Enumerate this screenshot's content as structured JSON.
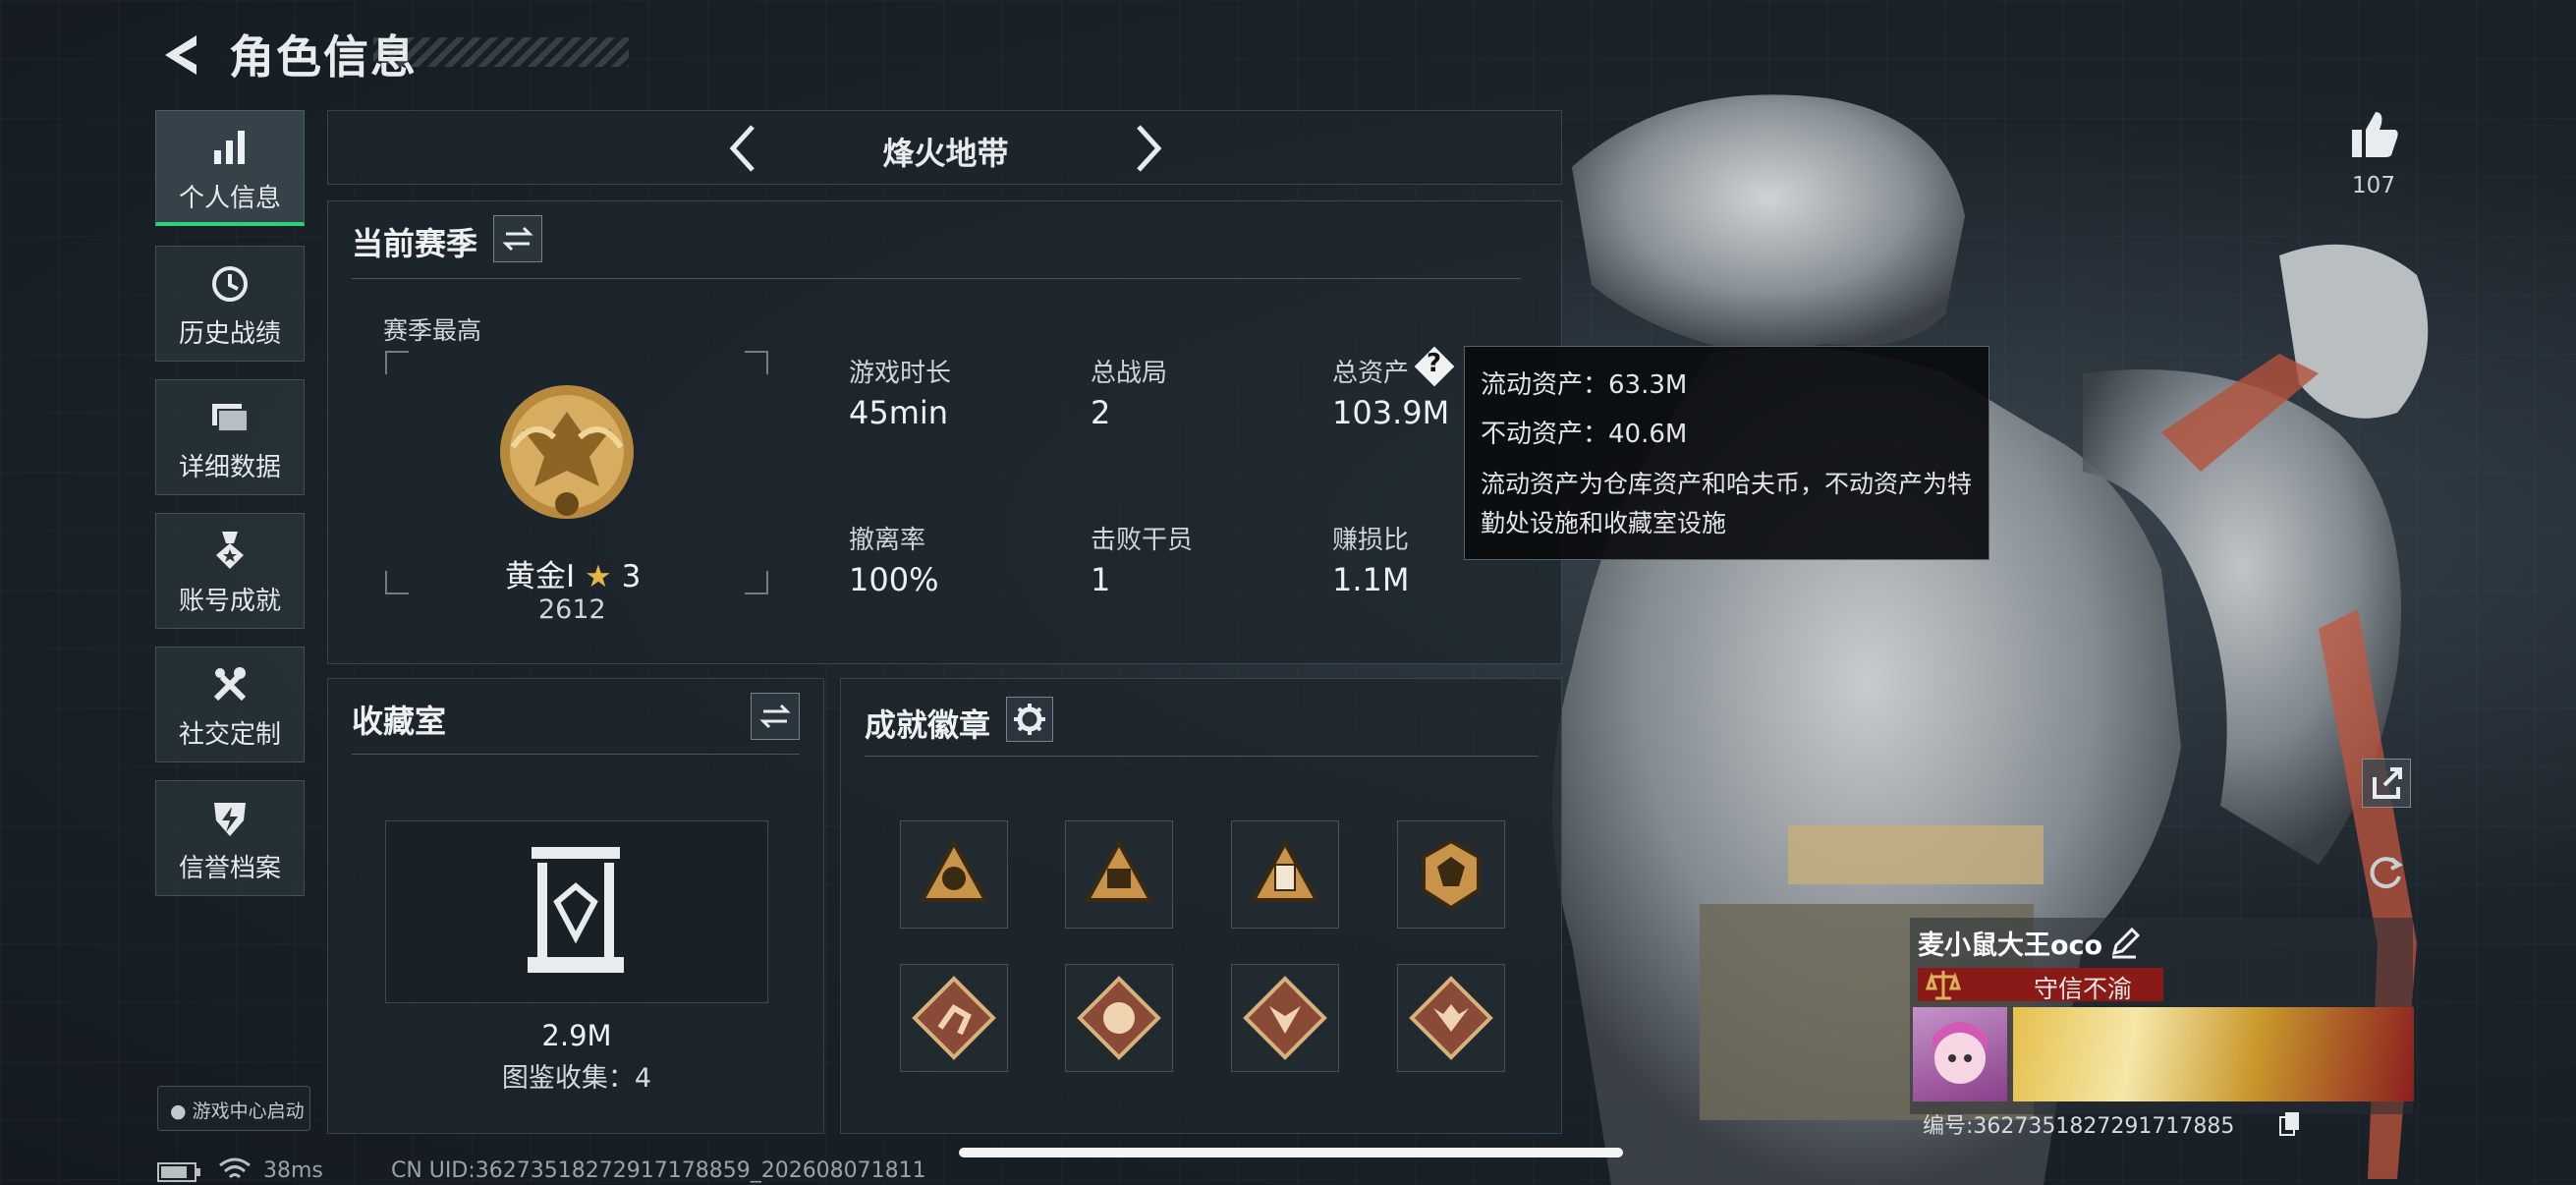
{
  "header": {
    "title": "角色信息"
  },
  "sidebar": {
    "items": [
      {
        "label": "个人信息",
        "icon": "bar-chart-icon",
        "active": true
      },
      {
        "label": "历史战绩",
        "icon": "history-clock-icon"
      },
      {
        "label": "详细数据",
        "icon": "folder-icon"
      },
      {
        "label": "账号成就",
        "icon": "medal-icon"
      },
      {
        "label": "社交定制",
        "icon": "tools-icon"
      },
      {
        "label": "信誉档案",
        "icon": "shield-bolt-icon"
      }
    ],
    "game_center": "游戏中心启动"
  },
  "mode": {
    "name": "烽火地带"
  },
  "season": {
    "title": "当前赛季",
    "best_label": "赛季最高",
    "rank_name": "黄金Ⅰ",
    "rank_stars": "3",
    "rank_score": "2612",
    "stats": [
      {
        "label": "游戏时长",
        "value": "45min"
      },
      {
        "label": "总战局",
        "value": "2"
      },
      {
        "label": "总资产",
        "value": "103.9M"
      },
      {
        "label": "撤离率",
        "value": "100%"
      },
      {
        "label": "击败干员",
        "value": "1"
      },
      {
        "label": "赚损比",
        "value": "1.1M"
      }
    ]
  },
  "tooltip": {
    "liquid": "流动资产：63.3M",
    "fixed": "不动资产：40.6M",
    "desc": "流动资产为仓库资产和哈夫币，不动资产为特勤处设施和收藏室设施"
  },
  "collection": {
    "title": "收藏室",
    "value": "2.9M",
    "count_text": "图鉴收集：4"
  },
  "achievements": {
    "title": "成就徽章",
    "badges": [
      "badge-54",
      "badge-55",
      "badge-58",
      "badge-hex",
      "badge-runner",
      "badge-dragon",
      "badge-wolf",
      "badge-beast"
    ]
  },
  "likes": {
    "count": "107"
  },
  "player": {
    "name": "麦小鼠大王oco",
    "title": "守信不渝",
    "uid_label": "编号:3627351827291717885"
  },
  "status_bar": {
    "ping": "38ms",
    "uid": "CN UID:3627351827291717885​9_202608071811"
  },
  "colors": {
    "accent_green": "#2fd07a",
    "gold": "#c79a4a",
    "trust_red": "#8a1a18"
  }
}
